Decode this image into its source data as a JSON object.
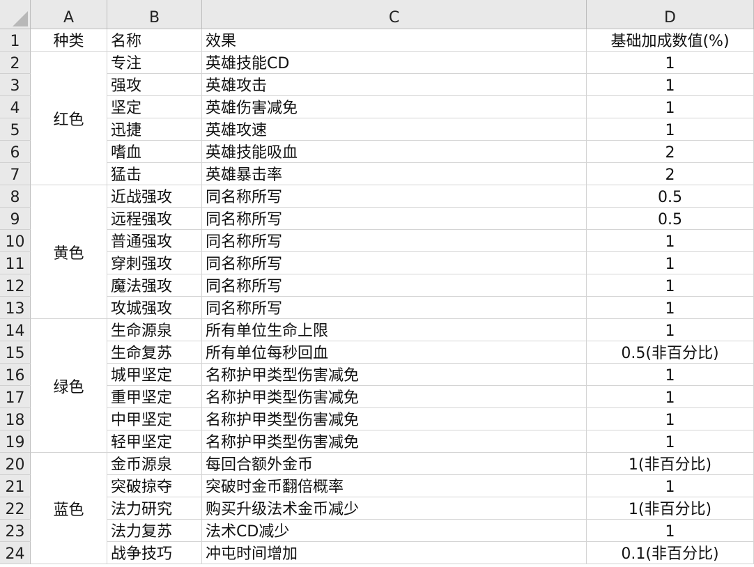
{
  "columns": [
    "A",
    "B",
    "C",
    "D"
  ],
  "header_row": {
    "number": "1",
    "a": "种类",
    "b": "名称",
    "c": "效果",
    "d": "基础加成数值(%)"
  },
  "groups": [
    {
      "category": "红色",
      "rows": [
        {
          "number": "2",
          "name": "专注",
          "effect": "英雄技能CD",
          "value": "1"
        },
        {
          "number": "3",
          "name": "强攻",
          "effect": "英雄攻击",
          "value": "1"
        },
        {
          "number": "4",
          "name": "坚定",
          "effect": "英雄伤害减免",
          "value": "1"
        },
        {
          "number": "5",
          "name": "迅捷",
          "effect": "英雄攻速",
          "value": "1"
        },
        {
          "number": "6",
          "name": "嗜血",
          "effect": "英雄技能吸血",
          "value": "2"
        },
        {
          "number": "7",
          "name": "猛击",
          "effect": "英雄暴击率",
          "value": "2"
        }
      ]
    },
    {
      "category": "黄色",
      "rows": [
        {
          "number": "8",
          "name": "近战强攻",
          "effect": "同名称所写",
          "value": "0.5"
        },
        {
          "number": "9",
          "name": "远程强攻",
          "effect": "同名称所写",
          "value": "0.5"
        },
        {
          "number": "10",
          "name": "普通强攻",
          "effect": "同名称所写",
          "value": "1"
        },
        {
          "number": "11",
          "name": "穿刺强攻",
          "effect": "同名称所写",
          "value": "1"
        },
        {
          "number": "12",
          "name": "魔法强攻",
          "effect": "同名称所写",
          "value": "1"
        },
        {
          "number": "13",
          "name": "攻城强攻",
          "effect": "同名称所写",
          "value": "1"
        }
      ]
    },
    {
      "category": "绿色",
      "rows": [
        {
          "number": "14",
          "name": "生命源泉",
          "effect": "所有单位生命上限",
          "value": "1"
        },
        {
          "number": "15",
          "name": "生命复苏",
          "effect": "所有单位每秒回血",
          "value": "0.5(非百分比)"
        },
        {
          "number": "16",
          "name": "城甲坚定",
          "effect": "名称护甲类型伤害减免",
          "value": "1"
        },
        {
          "number": "17",
          "name": "重甲坚定",
          "effect": "名称护甲类型伤害减免",
          "value": "1"
        },
        {
          "number": "18",
          "name": "中甲坚定",
          "effect": "名称护甲类型伤害减免",
          "value": "1"
        },
        {
          "number": "19",
          "name": "轻甲坚定",
          "effect": "名称护甲类型伤害减免",
          "value": "1"
        }
      ]
    },
    {
      "category": "蓝色",
      "rows": [
        {
          "number": "20",
          "name": "金币源泉",
          "effect": "每回合额外金币",
          "value": "1(非百分比)"
        },
        {
          "number": "21",
          "name": "突破掠夺",
          "effect": "突破时金币翻倍概率",
          "value": "1"
        },
        {
          "number": "22",
          "name": "法力研究",
          "effect": "购买升级法术金币减少",
          "value": "1(非百分比)"
        },
        {
          "number": "23",
          "name": "法力复苏",
          "effect": "法术CD减少",
          "value": "1"
        },
        {
          "number": "24",
          "name": "战争技巧",
          "effect": "冲屯时间增加",
          "value": "0.1(非百分比)"
        }
      ]
    }
  ],
  "colors": {
    "header_bg": "#e9e9e9",
    "gridline": "#d4d4d4",
    "header_border": "#bdbdbd"
  }
}
